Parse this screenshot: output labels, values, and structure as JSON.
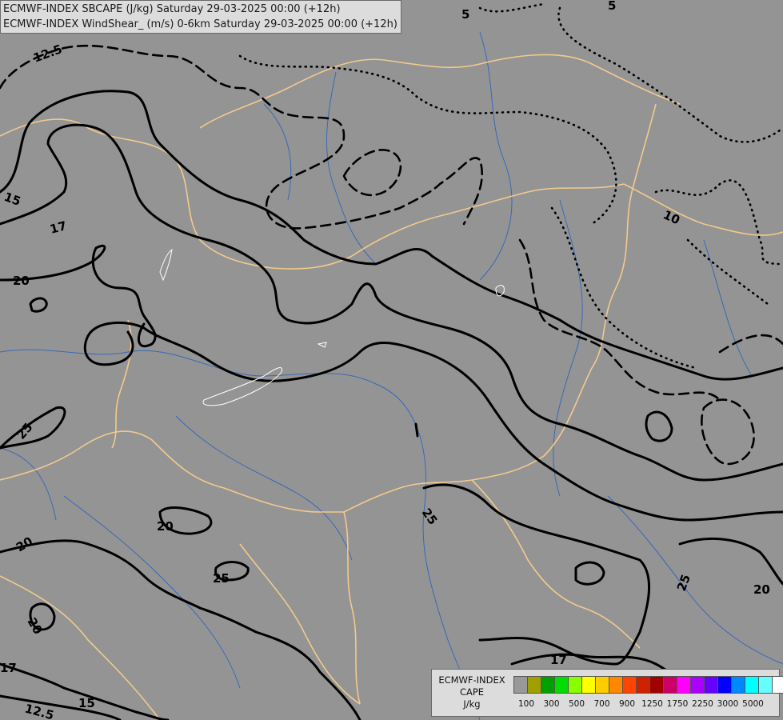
{
  "titles": {
    "line1": "ECMWF-INDEX SBCAPE (J/kg) Saturday 29-03-2025 00:00 (+12h)",
    "line2": "ECMWF-INDEX WindShear_ (m/s) 0-6km Saturday 29-03-2025 00:00 (+12h)"
  },
  "legend": {
    "caption_line1": "ECMWF-INDEX",
    "caption_line2": "CAPE",
    "caption_line3": "J/kg",
    "tick_labels": [
      "100",
      "300",
      "500",
      "700",
      "900",
      "1250",
      "1750",
      "2250",
      "3000",
      "5000"
    ],
    "colors": [
      "#999999",
      "#a0a000",
      "#00a000",
      "#00dd00",
      "#88ff00",
      "#ffff00",
      "#ffcc00",
      "#ff8800",
      "#ff4400",
      "#cc2200",
      "#a00000",
      "#cc0066",
      "#ff00ff",
      "#aa00ff",
      "#6600ff",
      "#0000ff",
      "#0088ff",
      "#00ffff",
      "#66ffff",
      "#ffffff"
    ]
  },
  "contour_labels": {
    "l12_5_top": "12.5",
    "l5_top": "5",
    "l5_edge": "5",
    "l15_left": "15",
    "l17_left": "17",
    "l20_left": "20",
    "l10_right": "10",
    "l25_left": "25",
    "l25_center": "25",
    "l20_mid": "20",
    "l20_lowleft": "20",
    "l25_low": "25",
    "l20_bottomleft": "20",
    "l25_right": "25",
    "l20_right": "20",
    "l17_bottom": "17",
    "l17_corner": "17",
    "l12_5_bottom": "12.5",
    "l15_bottom": "15"
  },
  "colors": {
    "background": "#949494",
    "borders": "#f2c98c",
    "rivers": "#3a68b8",
    "contours": "#000000"
  }
}
